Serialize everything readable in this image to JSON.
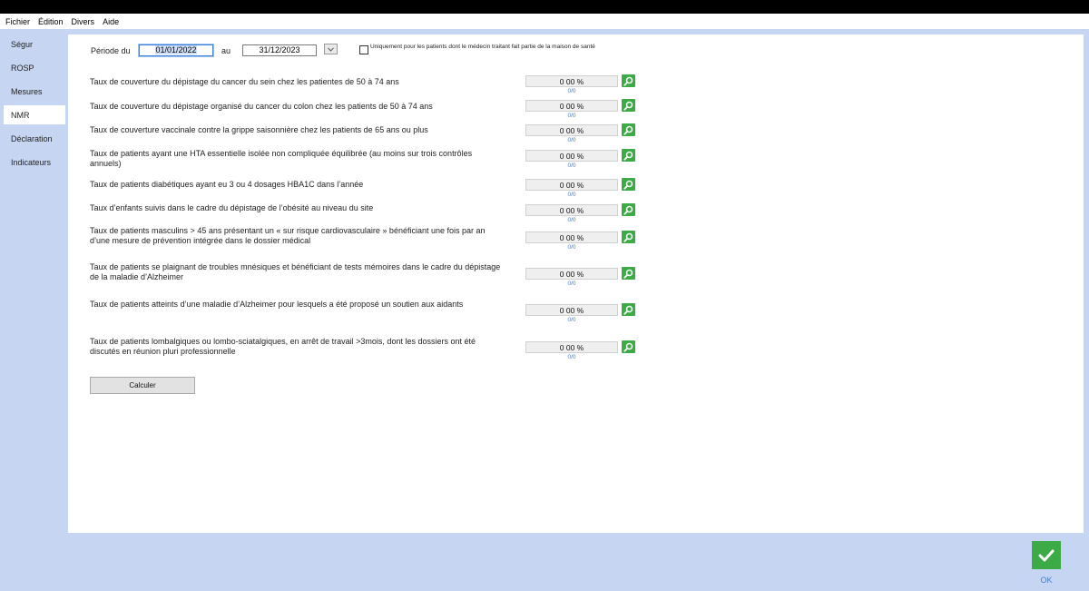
{
  "menu": [
    "Fichier",
    "Édition",
    "Divers",
    "Aide"
  ],
  "sidebar": {
    "items": [
      {
        "label": "Ségur"
      },
      {
        "label": "ROSP"
      },
      {
        "label": "Mesures"
      },
      {
        "label": "NMR"
      },
      {
        "label": "Déclaration"
      },
      {
        "label": "Indicateurs"
      }
    ],
    "active": "NMR"
  },
  "period": {
    "label_from": "Période du",
    "from": "01/01/2022",
    "label_to": "au",
    "to": "31/12/2023",
    "checkbox_label": "Uniquement pour les patients dont le médecin traitant fait partie de la maison de santé",
    "checked": false
  },
  "indicators": [
    {
      "label": "Taux de couverture du dépistage du cancer du sein chez les patientes de 50 à 74 ans",
      "value": "0 00 %",
      "ratio": "0/0"
    },
    {
      "label": "Taux de couverture du dépistage organisé du cancer du colon chez les patients de 50 à 74 ans",
      "value": "0 00 %",
      "ratio": "0/0"
    },
    {
      "label": "Taux de couverture vaccinale contre la grippe saisonnière chez les patients de 65 ans ou plus",
      "value": "0 00 %",
      "ratio": "0/0"
    },
    {
      "label": "Taux de patients ayant une HTA essentielle isolée non compliquée équilibrée (au moins sur trois contrôles annuels)",
      "value": "0 00 %",
      "ratio": "0/0"
    },
    {
      "label": "Taux de patients diabétiques ayant eu 3 ou 4 dosages HBA1C dans l’année",
      "value": "0 00 %",
      "ratio": "0/0"
    },
    {
      "label": "Taux d’enfants suivis dans le cadre du dépistage de l’obésité au niveau du site",
      "value": "0 00 %",
      "ratio": "0/0"
    },
    {
      "label": "Taux de patients masculins > 45 ans présentant un « sur risque cardiovasculaire » bénéficiant une fois par an d’une mesure de prévention intégrée dans le dossier médical",
      "value": "0 00 %",
      "ratio": "0/0"
    },
    {
      "label": "Taux de patients se plaignant de troubles mnésiques et bénéficiant de tests mémoires dans le cadre du dépistage de la maladie d’Alzheimer",
      "value": "0 00 %",
      "ratio": "0/0"
    },
    {
      "label": "Taux de patients atteints d’une maladie d’Alzheimer pour lesquels a été proposé un soutien aux aidants",
      "value": "0 00 %",
      "ratio": "0/0"
    },
    {
      "label": "Taux de patients lombalgiques ou lombo-sciatalgiques, en arrêt de travail >3mois, dont les dossiers ont été discutés en réunion pluri professionnelle",
      "value": "0 00 %",
      "ratio": "0/0"
    }
  ],
  "calculate_label": "Calculer",
  "ok_label": "OK",
  "colors": {
    "accent_green": "#3cab45",
    "link_blue": "#4a7cc7",
    "background": "#c6d6f2"
  },
  "icons": {
    "detail": "search-zoom-icon",
    "ok": "check-icon",
    "dropdown": "chevron-down-icon"
  }
}
